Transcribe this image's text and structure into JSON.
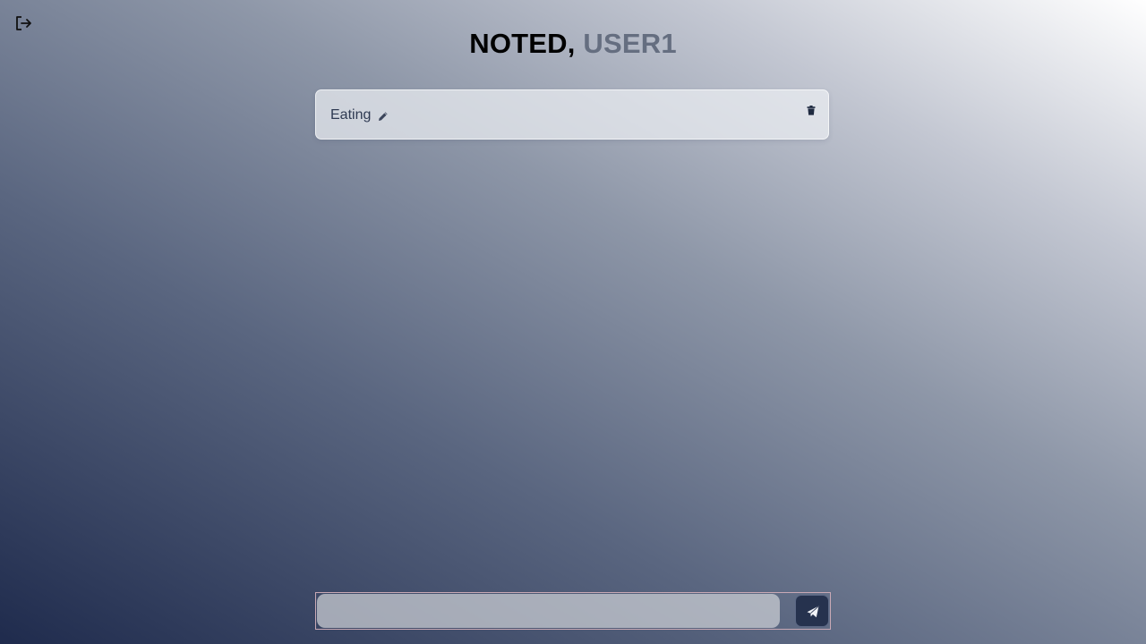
{
  "header": {
    "title_prefix": "NOTED,",
    "username": "USER1"
  },
  "icons": {
    "logout": "logout-icon",
    "edit": "pencil-icon",
    "delete": "trash-icon",
    "send": "send-icon"
  },
  "notes": [
    {
      "text": "Eating"
    }
  ],
  "composer": {
    "value": "",
    "placeholder": ""
  },
  "colors": {
    "title": "#000000",
    "username": "#656e80",
    "send_button": "#26324e",
    "note_text": "#2e3a52"
  }
}
